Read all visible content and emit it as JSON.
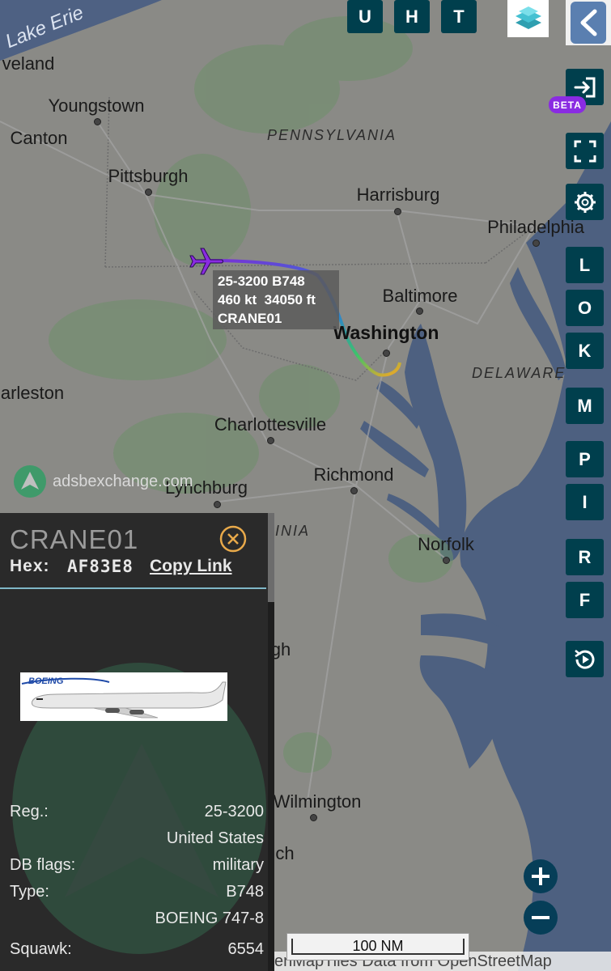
{
  "map": {
    "lake_label": "Lake Erie",
    "state_labels": [
      "PENNSYLVANIA",
      "DELAWARE",
      "VIRGINIA"
    ],
    "cities": [
      "veland",
      "Youngstown",
      "Canton",
      "Pittsburgh",
      "Harrisburg",
      "Philadelphia",
      "Baltimore",
      "Washington",
      "arleston",
      "Charlottesville",
      "Richmond",
      "Lynchburg",
      "Norfolk",
      "gh",
      "Wilmington",
      "ch"
    ],
    "watermark": "adsbexchange.com",
    "scale_label": "100 NM",
    "attribution": "enMapTiles Data from OpenStreetMap"
  },
  "top_buttons": [
    "U",
    "H",
    "T"
  ],
  "right_buttons": [
    "L",
    "O",
    "K",
    "M",
    "P",
    "I",
    "R",
    "F"
  ],
  "beta_badge": "BETA",
  "aircraft_label": {
    "line1": "25-3200 B748",
    "line2": "460 kt  34050 ft",
    "line3": "CRANE01"
  },
  "panel": {
    "callsign": "CRANE01",
    "hex_label": "Hex:",
    "hex_value": "AF83E8",
    "copy_link": "Copy Link",
    "rows": [
      {
        "label": "Reg.:",
        "value": "25-3200"
      },
      {
        "label": "",
        "value": "United States"
      },
      {
        "label": "DB flags:",
        "value": "military"
      },
      {
        "label": "Type:",
        "value": "B748"
      },
      {
        "label": "",
        "value": "BOEING 747-8"
      },
      {
        "label": "Squawk:",
        "value": "6554"
      }
    ],
    "image_brand": "BOEING"
  },
  "colors": {
    "button_bg": "#003f4d",
    "beta": "#8a2be2",
    "track_start": "#7b2fd6",
    "track_end": "#f5a623",
    "sea": "#4d6080"
  }
}
